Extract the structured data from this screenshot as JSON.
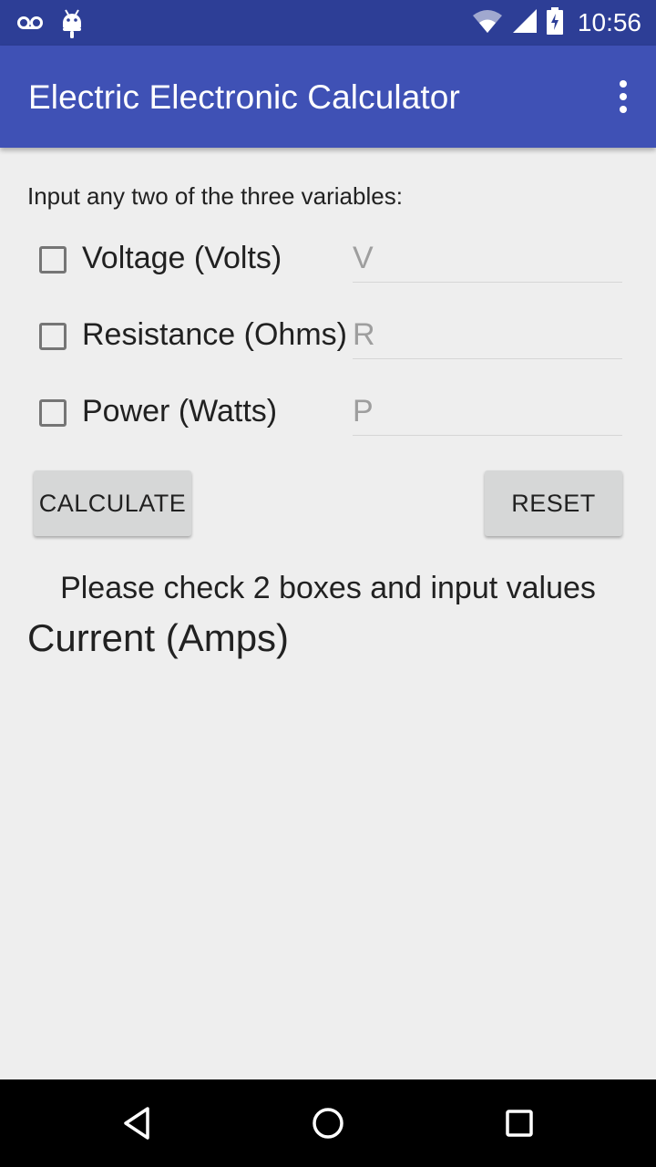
{
  "status_bar": {
    "time": "10:56",
    "icons": [
      "voicemail-icon",
      "android-icon",
      "wifi-icon",
      "signal-icon",
      "battery-charging-icon"
    ]
  },
  "app_bar": {
    "title": "Electric Electronic Calculator",
    "overflow_icon": "more-vert-icon"
  },
  "main": {
    "instruction": "Input any two of the three variables:",
    "rows": [
      {
        "label": "Voltage (Volts)",
        "placeholder": "V",
        "checked": false
      },
      {
        "label": "Resistance (Ohms)",
        "placeholder": "R",
        "checked": false
      },
      {
        "label": "Power (Watts)",
        "placeholder": "P",
        "checked": false
      }
    ],
    "buttons": {
      "calculate": "CALCULATE",
      "reset": "RESET"
    },
    "message": "Please check 2 boxes and input values",
    "result_label": "Current (Amps)"
  },
  "nav_bar": {
    "icons": [
      "back-icon",
      "home-icon",
      "recents-icon"
    ]
  },
  "colors": {
    "status_bar": "#2d3e96",
    "app_bar": "#3f51b5",
    "background": "#eeeeee",
    "button": "#d6d7d7"
  }
}
